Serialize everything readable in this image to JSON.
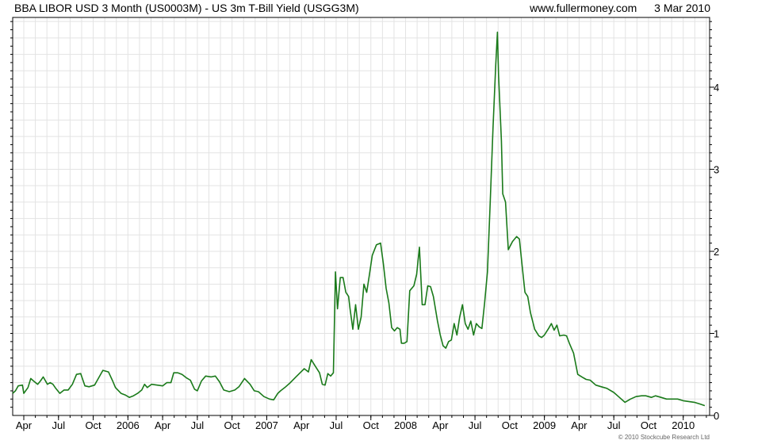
{
  "header": {
    "title": "BBA LIBOR USD 3 Month (US0003M) - US 3m T-Bill Yield (USGG3M)",
    "website": "www.fullermoney.com",
    "date": "3 Mar 2010"
  },
  "footer": {
    "copyright": "© 2010 Stockcube Research Ltd"
  },
  "colors": {
    "series": "#1a7a1a",
    "grid": "#e3e3e3",
    "axis": "#000000"
  },
  "chart_data": {
    "type": "line",
    "title": "BBA LIBOR USD 3 Month (US0003M) - US 3m T-Bill Yield (USGG3M)",
    "xlabel": "",
    "ylabel": "",
    "ylim": [
      0,
      4.85
    ],
    "xlim": [
      2005.17,
      2010.19
    ],
    "grid": true,
    "y_axis_position": "right",
    "y_ticks": [
      0,
      1,
      2,
      3,
      4
    ],
    "x_ticks": [
      {
        "label": "Apr",
        "x": 2005.25
      },
      {
        "label": "Jul",
        "x": 2005.5
      },
      {
        "label": "Oct",
        "x": 2005.75
      },
      {
        "label": "2006",
        "x": 2006.0
      },
      {
        "label": "Apr",
        "x": 2006.25
      },
      {
        "label": "Jul",
        "x": 2006.5
      },
      {
        "label": "Oct",
        "x": 2006.75
      },
      {
        "label": "2007",
        "x": 2007.0
      },
      {
        "label": "Apr",
        "x": 2007.25
      },
      {
        "label": "Jul",
        "x": 2007.5
      },
      {
        "label": "Oct",
        "x": 2007.75
      },
      {
        "label": "2008",
        "x": 2008.0
      },
      {
        "label": "Apr",
        "x": 2008.25
      },
      {
        "label": "Jul",
        "x": 2008.5
      },
      {
        "label": "Oct",
        "x": 2008.75
      },
      {
        "label": "2009",
        "x": 2009.0
      },
      {
        "label": "Apr",
        "x": 2009.25
      },
      {
        "label": "Jul",
        "x": 2009.5
      },
      {
        "label": "Oct",
        "x": 2009.75
      },
      {
        "label": "2010",
        "x": 2010.0
      }
    ],
    "series": [
      {
        "name": "",
        "points": [
          [
            2005.17,
            0.27
          ],
          [
            2005.19,
            0.3
          ],
          [
            2005.21,
            0.36
          ],
          [
            2005.24,
            0.37
          ],
          [
            2005.25,
            0.27
          ],
          [
            2005.28,
            0.34
          ],
          [
            2005.3,
            0.45
          ],
          [
            2005.32,
            0.42
          ],
          [
            2005.35,
            0.38
          ],
          [
            2005.37,
            0.42
          ],
          [
            2005.39,
            0.47
          ],
          [
            2005.42,
            0.38
          ],
          [
            2005.44,
            0.4
          ],
          [
            2005.46,
            0.38
          ],
          [
            2005.48,
            0.33
          ],
          [
            2005.51,
            0.27
          ],
          [
            2005.54,
            0.31
          ],
          [
            2005.57,
            0.31
          ],
          [
            2005.6,
            0.38
          ],
          [
            2005.63,
            0.5
          ],
          [
            2005.66,
            0.51
          ],
          [
            2005.69,
            0.36
          ],
          [
            2005.72,
            0.35
          ],
          [
            2005.76,
            0.37
          ],
          [
            2005.78,
            0.43
          ],
          [
            2005.82,
            0.55
          ],
          [
            2005.86,
            0.53
          ],
          [
            2005.89,
            0.42
          ],
          [
            2005.91,
            0.34
          ],
          [
            2005.95,
            0.27
          ],
          [
            2005.98,
            0.25
          ],
          [
            2006.01,
            0.22
          ],
          [
            2006.04,
            0.24
          ],
          [
            2006.07,
            0.27
          ],
          [
            2006.1,
            0.31
          ],
          [
            2006.12,
            0.38
          ],
          [
            2006.14,
            0.34
          ],
          [
            2006.17,
            0.38
          ],
          [
            2006.21,
            0.37
          ],
          [
            2006.25,
            0.36
          ],
          [
            2006.28,
            0.4
          ],
          [
            2006.31,
            0.4
          ],
          [
            2006.33,
            0.52
          ],
          [
            2006.36,
            0.52
          ],
          [
            2006.39,
            0.5
          ],
          [
            2006.42,
            0.46
          ],
          [
            2006.45,
            0.43
          ],
          [
            2006.48,
            0.32
          ],
          [
            2006.5,
            0.3
          ],
          [
            2006.53,
            0.42
          ],
          [
            2006.56,
            0.48
          ],
          [
            2006.6,
            0.47
          ],
          [
            2006.63,
            0.48
          ],
          [
            2006.66,
            0.41
          ],
          [
            2006.69,
            0.31
          ],
          [
            2006.73,
            0.29
          ],
          [
            2006.77,
            0.31
          ],
          [
            2006.8,
            0.35
          ],
          [
            2006.84,
            0.45
          ],
          [
            2006.88,
            0.38
          ],
          [
            2006.91,
            0.3
          ],
          [
            2006.94,
            0.29
          ],
          [
            2006.98,
            0.23
          ],
          [
            2007.02,
            0.2
          ],
          [
            2007.05,
            0.19
          ],
          [
            2007.08,
            0.27
          ],
          [
            2007.1,
            0.3
          ],
          [
            2007.13,
            0.34
          ],
          [
            2007.17,
            0.4
          ],
          [
            2007.21,
            0.47
          ],
          [
            2007.24,
            0.52
          ],
          [
            2007.27,
            0.57
          ],
          [
            2007.3,
            0.53
          ],
          [
            2007.32,
            0.68
          ],
          [
            2007.35,
            0.6
          ],
          [
            2007.38,
            0.52
          ],
          [
            2007.4,
            0.38
          ],
          [
            2007.42,
            0.37
          ],
          [
            2007.44,
            0.51
          ],
          [
            2007.46,
            0.48
          ],
          [
            2007.48,
            0.52
          ],
          [
            2007.495,
            1.75
          ],
          [
            2007.51,
            1.3
          ],
          [
            2007.53,
            1.68
          ],
          [
            2007.55,
            1.68
          ],
          [
            2007.57,
            1.5
          ],
          [
            2007.59,
            1.45
          ],
          [
            2007.6,
            1.3
          ],
          [
            2007.62,
            1.05
          ],
          [
            2007.64,
            1.35
          ],
          [
            2007.66,
            1.05
          ],
          [
            2007.68,
            1.2
          ],
          [
            2007.7,
            1.6
          ],
          [
            2007.72,
            1.5
          ],
          [
            2007.74,
            1.72
          ],
          [
            2007.76,
            1.95
          ],
          [
            2007.79,
            2.08
          ],
          [
            2007.82,
            2.1
          ],
          [
            2007.84,
            1.85
          ],
          [
            2007.86,
            1.55
          ],
          [
            2007.88,
            1.37
          ],
          [
            2007.9,
            1.07
          ],
          [
            2007.92,
            1.03
          ],
          [
            2007.94,
            1.07
          ],
          [
            2007.96,
            1.05
          ],
          [
            2007.97,
            0.88
          ],
          [
            2007.99,
            0.88
          ],
          [
            2008.01,
            0.9
          ],
          [
            2008.03,
            1.52
          ],
          [
            2008.06,
            1.58
          ],
          [
            2008.08,
            1.72
          ],
          [
            2008.1,
            2.05
          ],
          [
            2008.12,
            1.35
          ],
          [
            2008.14,
            1.35
          ],
          [
            2008.16,
            1.58
          ],
          [
            2008.18,
            1.57
          ],
          [
            2008.2,
            1.45
          ],
          [
            2008.23,
            1.15
          ],
          [
            2008.25,
            0.98
          ],
          [
            2008.27,
            0.85
          ],
          [
            2008.29,
            0.82
          ],
          [
            2008.31,
            0.9
          ],
          [
            2008.33,
            0.92
          ],
          [
            2008.35,
            1.12
          ],
          [
            2008.37,
            0.98
          ],
          [
            2008.39,
            1.2
          ],
          [
            2008.41,
            1.35
          ],
          [
            2008.43,
            1.12
          ],
          [
            2008.45,
            1.05
          ],
          [
            2008.47,
            1.15
          ],
          [
            2008.49,
            0.98
          ],
          [
            2008.51,
            1.12
          ],
          [
            2008.53,
            1.08
          ],
          [
            2008.55,
            1.06
          ],
          [
            2008.57,
            1.38
          ],
          [
            2008.59,
            1.75
          ],
          [
            2008.61,
            2.6
          ],
          [
            2008.63,
            3.5
          ],
          [
            2008.65,
            4.28
          ],
          [
            2008.662,
            4.67
          ],
          [
            2008.67,
            4.15
          ],
          [
            2008.69,
            3.35
          ],
          [
            2008.7,
            2.7
          ],
          [
            2008.72,
            2.6
          ],
          [
            2008.74,
            2.02
          ],
          [
            2008.77,
            2.12
          ],
          [
            2008.8,
            2.18
          ],
          [
            2008.82,
            2.15
          ],
          [
            2008.84,
            1.82
          ],
          [
            2008.86,
            1.5
          ],
          [
            2008.88,
            1.45
          ],
          [
            2008.9,
            1.25
          ],
          [
            2008.93,
            1.05
          ],
          [
            2008.96,
            0.97
          ],
          [
            2008.98,
            0.95
          ],
          [
            2009.0,
            0.98
          ],
          [
            2009.03,
            1.06
          ],
          [
            2009.05,
            1.12
          ],
          [
            2009.07,
            1.04
          ],
          [
            2009.09,
            1.1
          ],
          [
            2009.11,
            0.97
          ],
          [
            2009.14,
            0.98
          ],
          [
            2009.16,
            0.97
          ],
          [
            2009.18,
            0.88
          ],
          [
            2009.21,
            0.76
          ],
          [
            2009.24,
            0.5
          ],
          [
            2009.27,
            0.47
          ],
          [
            2009.3,
            0.44
          ],
          [
            2009.33,
            0.43
          ],
          [
            2009.37,
            0.37
          ],
          [
            2009.41,
            0.35
          ],
          [
            2009.45,
            0.33
          ],
          [
            2009.5,
            0.28
          ],
          [
            2009.54,
            0.22
          ],
          [
            2009.58,
            0.16
          ],
          [
            2009.62,
            0.2
          ],
          [
            2009.66,
            0.23
          ],
          [
            2009.7,
            0.24
          ],
          [
            2009.73,
            0.24
          ],
          [
            2009.77,
            0.22
          ],
          [
            2009.8,
            0.24
          ],
          [
            2009.84,
            0.22
          ],
          [
            2009.88,
            0.2
          ],
          [
            2009.92,
            0.2
          ],
          [
            2009.96,
            0.2
          ],
          [
            2010.0,
            0.18
          ],
          [
            2010.04,
            0.17
          ],
          [
            2010.08,
            0.16
          ],
          [
            2010.12,
            0.14
          ],
          [
            2010.155,
            0.12
          ]
        ]
      }
    ]
  }
}
